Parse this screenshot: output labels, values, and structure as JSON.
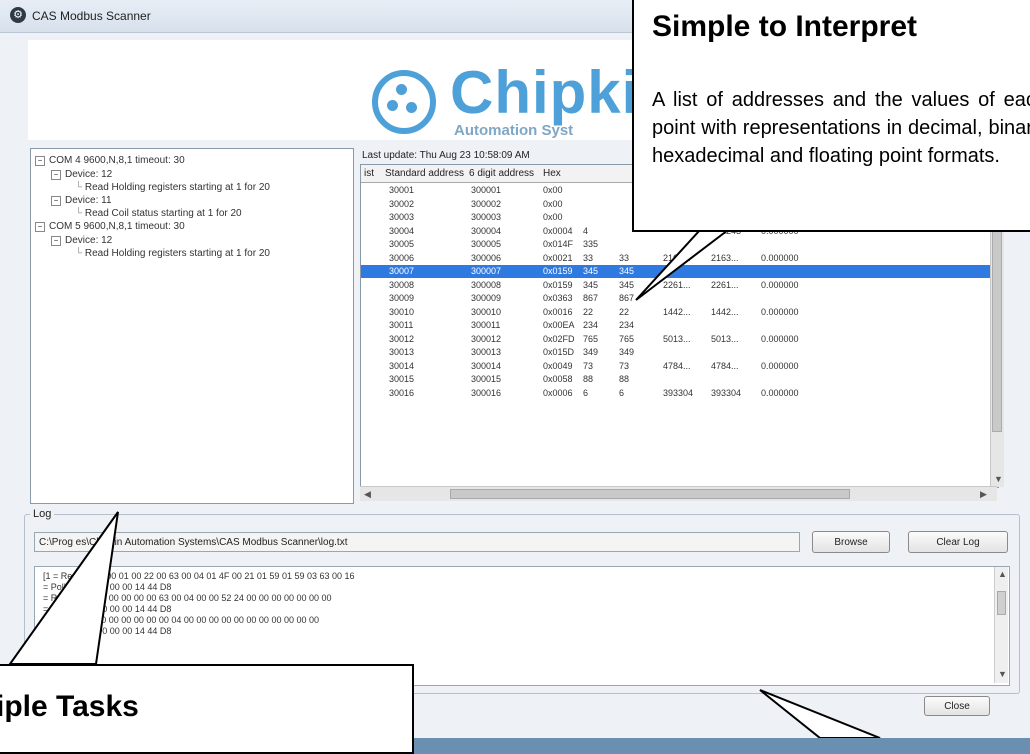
{
  "window": {
    "title": "CAS Modbus Scanner"
  },
  "logo": {
    "name": "Chipki",
    "subtitle": "Automation Syst"
  },
  "tree": {
    "items": [
      {
        "toggle": "−",
        "label": "COM 4 9600,N,8,1 timeout: 30"
      },
      {
        "toggle": "−",
        "label": "Device: 12"
      },
      {
        "toggle": "",
        "label": "Read Holding registers starting at 1 for 20"
      },
      {
        "toggle": "−",
        "label": "Device: 11"
      },
      {
        "toggle": "",
        "label": "Read Coil status starting at 1 for 20"
      },
      {
        "toggle": "−",
        "label": "COM 5 9600,N,8,1 timeout: 30"
      },
      {
        "toggle": "−",
        "label": "Device: 12"
      },
      {
        "toggle": "",
        "label": "Read Holding registers starting at 1 for 20"
      }
    ]
  },
  "last_update": "Last update: Thu Aug 23 10:58:09 AM",
  "grid": {
    "columns": [
      "ist",
      "Standard address",
      "6 digit address",
      "Hex"
    ],
    "rows": [
      [
        "30001",
        "300001",
        "0x00",
        "",
        "",
        "",
        "",
        ""
      ],
      [
        "30002",
        "300002",
        "0x00",
        "",
        "",
        "",
        "",
        ""
      ],
      [
        "30003",
        "300003",
        "0x00",
        "",
        "",
        "",
        "",
        ""
      ],
      [
        "30004",
        "300004",
        "0x0004",
        "4",
        "",
        "",
        "262243",
        "0.000000"
      ],
      [
        "30005",
        "300005",
        "0x014F",
        "335",
        "",
        "",
        "",
        ""
      ],
      [
        "30006",
        "300006",
        "0x0021",
        "33",
        "33",
        "2163...",
        "2163...",
        "0.000000"
      ],
      [
        "30007",
        "300007",
        "0x0159",
        "345",
        "345",
        "",
        "",
        ""
      ],
      [
        "30008",
        "300008",
        "0x0159",
        "345",
        "345",
        "2261...",
        "2261...",
        "0.000000"
      ],
      [
        "30009",
        "300009",
        "0x0363",
        "867",
        "867",
        "",
        "",
        ""
      ],
      [
        "30010",
        "300010",
        "0x0016",
        "22",
        "22",
        "1442...",
        "1442...",
        "0.000000"
      ],
      [
        "30011",
        "300011",
        "0x00EA",
        "234",
        "234",
        "",
        "",
        ""
      ],
      [
        "30012",
        "300012",
        "0x02FD",
        "765",
        "765",
        "5013...",
        "5013...",
        "0.000000"
      ],
      [
        "30013",
        "300013",
        "0x015D",
        "349",
        "349",
        "",
        "",
        ""
      ],
      [
        "30014",
        "300014",
        "0x0049",
        "73",
        "73",
        "4784...",
        "4784...",
        "0.000000"
      ],
      [
        "30015",
        "300015",
        "0x0058",
        "88",
        "88",
        "",
        "",
        ""
      ],
      [
        "30016",
        "300016",
        "0x0006",
        "6",
        "6",
        "393304",
        "393304",
        "0.000000"
      ]
    ],
    "selected_row_index": 6
  },
  "log": {
    "label": "Log",
    "path": "C:\\Prog    es\\Chipkin Automation Systems\\CAS Modbus Scanner\\log.txt",
    "browse_label": "Browse",
    "clear_label": "Clear Log",
    "lines": [
      "[1            = Response: 00 01 00 22 00 63 00 04 01 4F 00 21 01 59 01 59 03 63 00 16",
      "                = Poll: 0C 03 00 00 00 14 44 D8",
      "                = Response: 00 00 00 00 00 63 00 04 00 00 52 24 00 00 00 00 00 00 00",
      "                = Poll: 0C 03 00 00 00 14 44 D8",
      "                = Response: 00 00 00 00 00 00 04 00 00 00 00 00 00 00 00 00 00 00",
      "                = Poll: 0C 03 00 00 00 14 44 D8"
    ]
  },
  "close_label": "Close",
  "callouts": {
    "top_title": "Simple to Interpret",
    "top_body": "A list of addresses and the values of each point with representations in decimal, binary, hexadecimal and floating point formats.",
    "bottom_title": "iple Tasks"
  }
}
